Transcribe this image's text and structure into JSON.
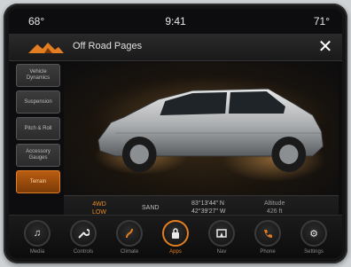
{
  "status": {
    "temp_left": "68°",
    "time": "9:41",
    "temp_right": "71°"
  },
  "header": {
    "title": "Off Road Pages"
  },
  "tabs": [
    {
      "label": "Vehicle Dynamics"
    },
    {
      "label": "Suspension"
    },
    {
      "label": "Pitch & Roll"
    },
    {
      "label": "Accessory Gauges"
    },
    {
      "label": "Terrain",
      "active": true
    }
  ],
  "info": {
    "mode_line1": "4WD",
    "mode_line2": "LOW",
    "sand": "SAND",
    "coord1": "83°13'44\" N",
    "coord2": "42°39'27\" W",
    "altitude_label": "Altitude",
    "altitude_value": "426 ft"
  },
  "nav": [
    {
      "label": "Media",
      "icon": "music-icon"
    },
    {
      "label": "Controls",
      "icon": "wrench-icon"
    },
    {
      "label": "Climate",
      "icon": "climate-icon"
    },
    {
      "label": "Apps",
      "icon": "apps-icon",
      "active": true
    },
    {
      "label": "Nav",
      "icon": "nav-icon"
    },
    {
      "label": "Phone",
      "icon": "phone-icon"
    },
    {
      "label": "Settings",
      "icon": "settings-icon"
    }
  ],
  "colors": {
    "accent": "#e27d21",
    "background": "#0d0d0f"
  }
}
